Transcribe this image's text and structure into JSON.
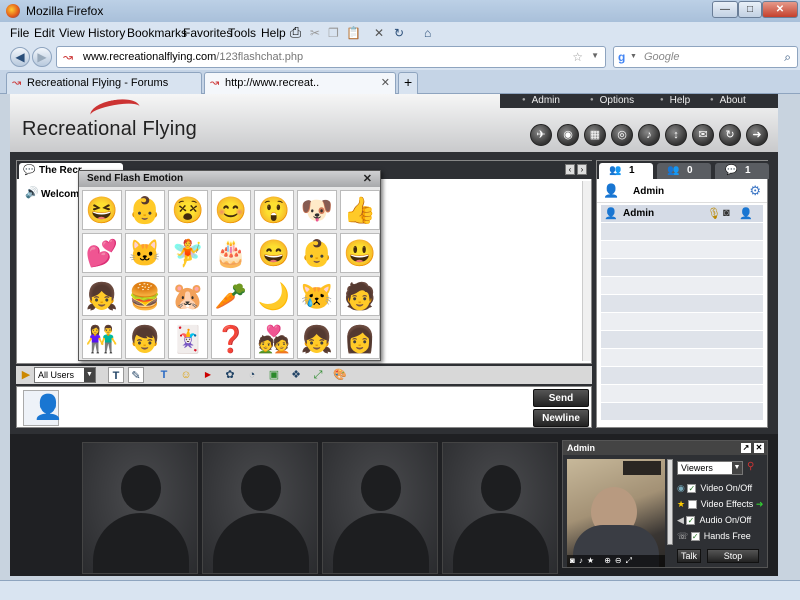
{
  "window": {
    "title": "Mozilla Firefox",
    "min": "—",
    "max": "□",
    "close": "✕"
  },
  "menu": [
    "File",
    "Edit",
    "View",
    "History",
    "Bookmarks",
    "Favorites",
    "Tools",
    "Help"
  ],
  "address": {
    "host": "www.recreationalflying.com",
    "path": "/123flashchat.php"
  },
  "search": {
    "placeholder": "Google"
  },
  "tabs": [
    {
      "label": "Recreational Flying - Forums"
    },
    {
      "label": "http://www.recreat.."
    }
  ],
  "app": {
    "logo": "Recreational Flying",
    "toplinks": [
      "Admin",
      "Options",
      "Help",
      "About"
    ],
    "chat_tab": "The Recr",
    "welcome": "Welcom",
    "emotion_popup_title": "Send Flash Emotion",
    "emotions": [
      "😆",
      "👶",
      "😵",
      "😊",
      "😲",
      "🐶",
      "👍",
      "💕",
      "🐱",
      "🧚",
      "🎂",
      "😄",
      "👶",
      "😃",
      "👧",
      "🍔",
      "🐹",
      "🥕",
      "🌙",
      "😿",
      "🧑",
      "👫",
      "👦",
      "🃏",
      "❓",
      "💑",
      "👧",
      "👩"
    ],
    "user_filter": "All Users",
    "send": "Send",
    "newline": "Newline",
    "right_tabs": [
      "1",
      "0",
      "1"
    ],
    "room_user_header": "Admin",
    "users": [
      {
        "name": "Admin"
      }
    ],
    "admin_cam_title": "Admin",
    "viewers_select": "Viewers",
    "options": [
      {
        "label": "Video On/Off",
        "checked": true
      },
      {
        "label": "Video Effects",
        "checked": false
      },
      {
        "label": "Audio On/Off",
        "checked": true
      },
      {
        "label": "Hands Free",
        "checked": true
      }
    ],
    "talk": "Talk",
    "stop": "Stop"
  },
  "colors": {
    "accent_red": "#cc3333",
    "panel_dark": "#2e3034"
  }
}
